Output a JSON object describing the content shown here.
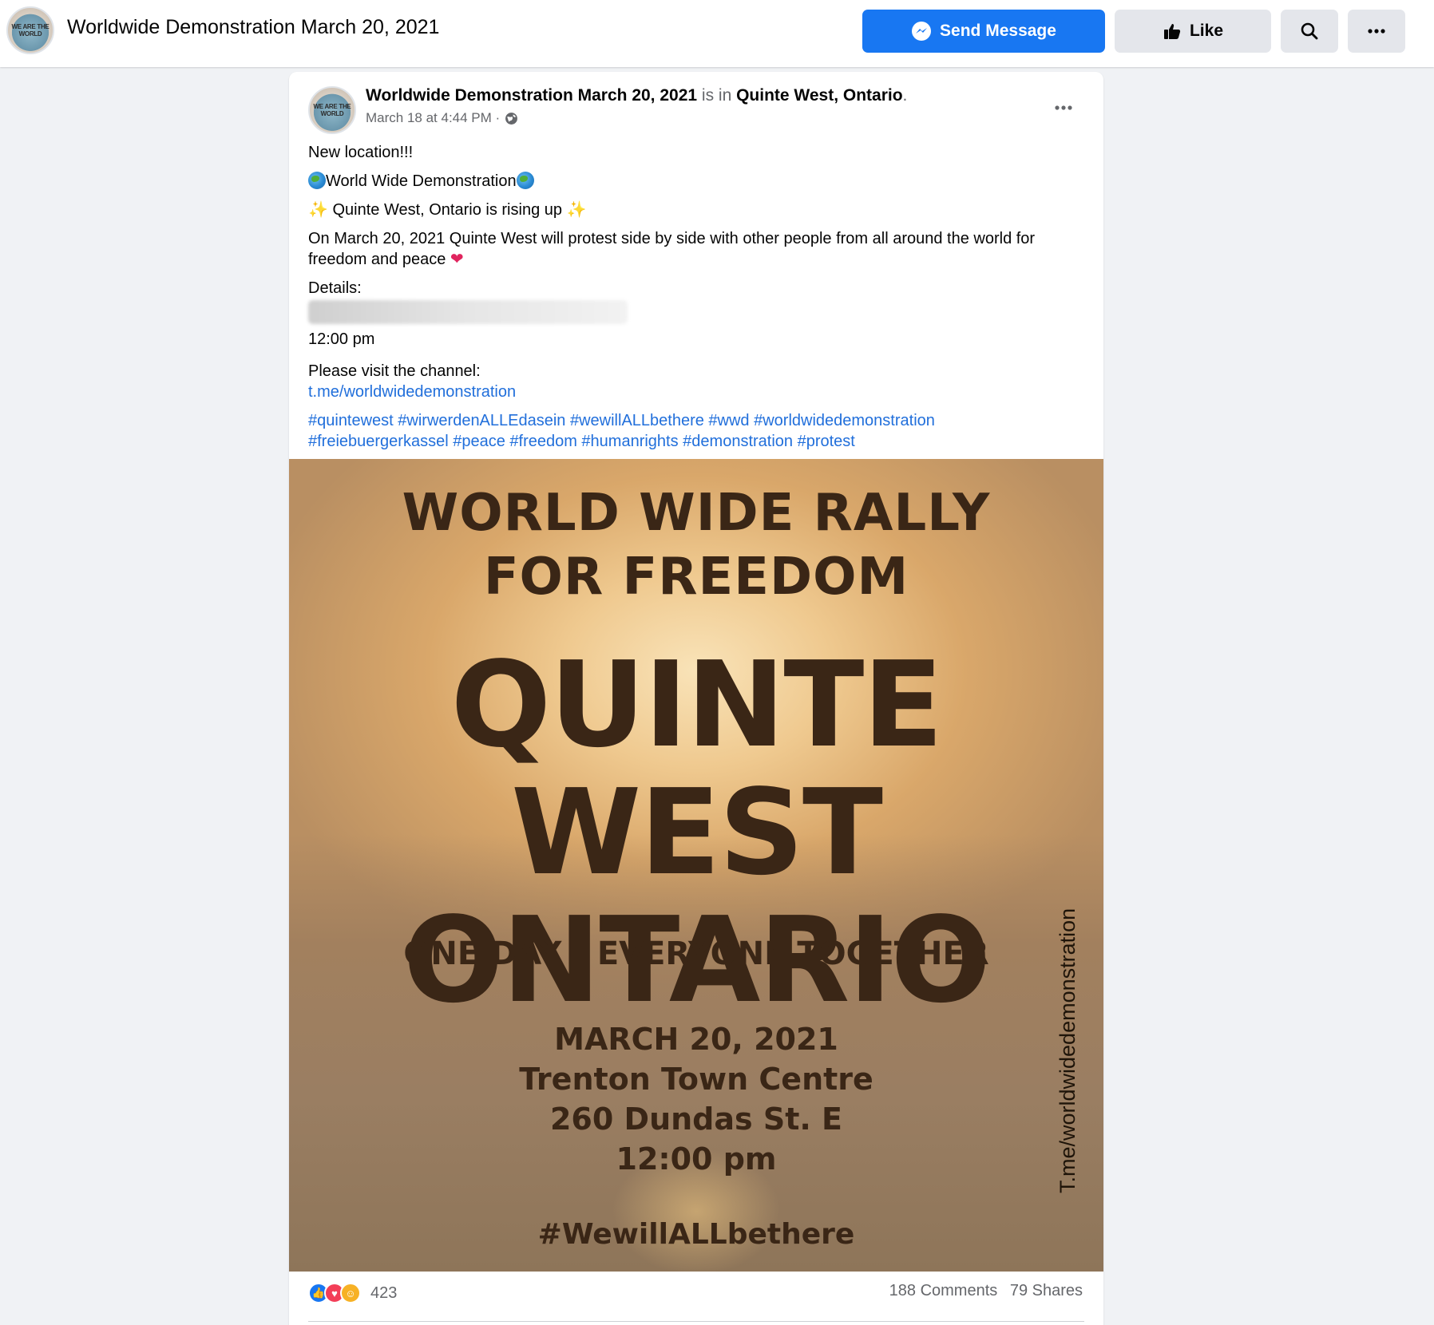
{
  "header": {
    "page_title": "Worldwide Demonstration March 20, 2021",
    "avatar_text": "WE ARE THE WORLD",
    "send_message_label": "Send Message",
    "like_label": "Like"
  },
  "post": {
    "author": "Worldwide Demonstration March 20, 2021",
    "is_in": " is in ",
    "location": "Quinte West, Ontario",
    "period": ".",
    "timestamp": "March 18 at 4:44 PM ·",
    "lines": {
      "new_location": "New location!!!",
      "title": "World Wide Demonstration",
      "rising": " Quinte West, Ontario is rising up ",
      "protest": "On March 20, 2021 Quinte West will protest side by side with other people from all around the world for freedom and peace ",
      "details": "Details:",
      "time": "12:00 pm",
      "visit": "Please visit the channel:",
      "channel_link": "t.me/worldwidedemonstration",
      "hashtags_line1": "#quintewest #wirwerdenALLEdasein #wewillALLbethere #wwd #worldwidedemonstration",
      "hashtags_line2": "#freiebuergerkassel #peace #freedom #humanrights #demonstration #protest"
    }
  },
  "poster": {
    "headline_1": "WORLD WIDE RALLY",
    "headline_2": "FOR FREEDOM",
    "city_1": "QUINTE WEST",
    "city_2": "ONTARIO",
    "tagline": "ONE DAY - EVERYONE TOGETHER",
    "date": "MARCH 20, 2021",
    "venue": "Trenton Town Centre",
    "address": "260 Dundas St. E",
    "time": "12:00 pm",
    "hashtag": "#WewillALLbethere",
    "side_text": "T.me/worldwidedemonstration"
  },
  "engagement": {
    "reaction_count": "423",
    "comments": "188 Comments",
    "shares": "79 Shares"
  },
  "colors": {
    "brand_blue": "#1877f2",
    "link_blue": "#216fdb",
    "poster_text": "#3a2616"
  }
}
